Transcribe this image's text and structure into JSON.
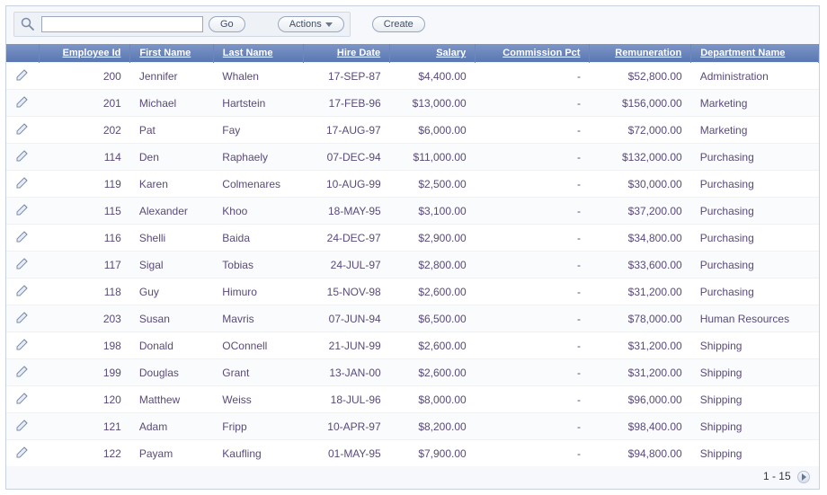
{
  "toolbar": {
    "go_label": "Go",
    "actions_label": "Actions",
    "create_label": "Create",
    "search_value": "",
    "search_placeholder": ""
  },
  "columns": {
    "employee_id": "Employee Id",
    "first_name": "First Name",
    "last_name": "Last Name",
    "hire_date": "Hire Date",
    "salary": "Salary",
    "commission_pct": "Commission Pct",
    "remuneration": "Remuneration",
    "department_name": "Department Name"
  },
  "rows": [
    {
      "employee_id": "200",
      "first_name": "Jennifer",
      "last_name": "Whalen",
      "hire_date": "17-SEP-87",
      "salary": "$4,400.00",
      "commission_pct": "-",
      "remuneration": "$52,800.00",
      "department_name": "Administration"
    },
    {
      "employee_id": "201",
      "first_name": "Michael",
      "last_name": "Hartstein",
      "hire_date": "17-FEB-96",
      "salary": "$13,000.00",
      "commission_pct": "-",
      "remuneration": "$156,000.00",
      "department_name": "Marketing"
    },
    {
      "employee_id": "202",
      "first_name": "Pat",
      "last_name": "Fay",
      "hire_date": "17-AUG-97",
      "salary": "$6,000.00",
      "commission_pct": "-",
      "remuneration": "$72,000.00",
      "department_name": "Marketing"
    },
    {
      "employee_id": "114",
      "first_name": "Den",
      "last_name": "Raphaely",
      "hire_date": "07-DEC-94",
      "salary": "$11,000.00",
      "commission_pct": "-",
      "remuneration": "$132,000.00",
      "department_name": "Purchasing"
    },
    {
      "employee_id": "119",
      "first_name": "Karen",
      "last_name": "Colmenares",
      "hire_date": "10-AUG-99",
      "salary": "$2,500.00",
      "commission_pct": "-",
      "remuneration": "$30,000.00",
      "department_name": "Purchasing"
    },
    {
      "employee_id": "115",
      "first_name": "Alexander",
      "last_name": "Khoo",
      "hire_date": "18-MAY-95",
      "salary": "$3,100.00",
      "commission_pct": "-",
      "remuneration": "$37,200.00",
      "department_name": "Purchasing"
    },
    {
      "employee_id": "116",
      "first_name": "Shelli",
      "last_name": "Baida",
      "hire_date": "24-DEC-97",
      "salary": "$2,900.00",
      "commission_pct": "-",
      "remuneration": "$34,800.00",
      "department_name": "Purchasing"
    },
    {
      "employee_id": "117",
      "first_name": "Sigal",
      "last_name": "Tobias",
      "hire_date": "24-JUL-97",
      "salary": "$2,800.00",
      "commission_pct": "-",
      "remuneration": "$33,600.00",
      "department_name": "Purchasing"
    },
    {
      "employee_id": "118",
      "first_name": "Guy",
      "last_name": "Himuro",
      "hire_date": "15-NOV-98",
      "salary": "$2,600.00",
      "commission_pct": "-",
      "remuneration": "$31,200.00",
      "department_name": "Purchasing"
    },
    {
      "employee_id": "203",
      "first_name": "Susan",
      "last_name": "Mavris",
      "hire_date": "07-JUN-94",
      "salary": "$6,500.00",
      "commission_pct": "-",
      "remuneration": "$78,000.00",
      "department_name": "Human Resources"
    },
    {
      "employee_id": "198",
      "first_name": "Donald",
      "last_name": "OConnell",
      "hire_date": "21-JUN-99",
      "salary": "$2,600.00",
      "commission_pct": "-",
      "remuneration": "$31,200.00",
      "department_name": "Shipping"
    },
    {
      "employee_id": "199",
      "first_name": "Douglas",
      "last_name": "Grant",
      "hire_date": "13-JAN-00",
      "salary": "$2,600.00",
      "commission_pct": "-",
      "remuneration": "$31,200.00",
      "department_name": "Shipping"
    },
    {
      "employee_id": "120",
      "first_name": "Matthew",
      "last_name": "Weiss",
      "hire_date": "18-JUL-96",
      "salary": "$8,000.00",
      "commission_pct": "-",
      "remuneration": "$96,000.00",
      "department_name": "Shipping"
    },
    {
      "employee_id": "121",
      "first_name": "Adam",
      "last_name": "Fripp",
      "hire_date": "10-APR-97",
      "salary": "$8,200.00",
      "commission_pct": "-",
      "remuneration": "$98,400.00",
      "department_name": "Shipping"
    },
    {
      "employee_id": "122",
      "first_name": "Payam",
      "last_name": "Kaufling",
      "hire_date": "01-MAY-95",
      "salary": "$7,900.00",
      "commission_pct": "-",
      "remuneration": "$94,800.00",
      "department_name": "Shipping"
    }
  ],
  "footer": {
    "range": "1 - 15"
  }
}
